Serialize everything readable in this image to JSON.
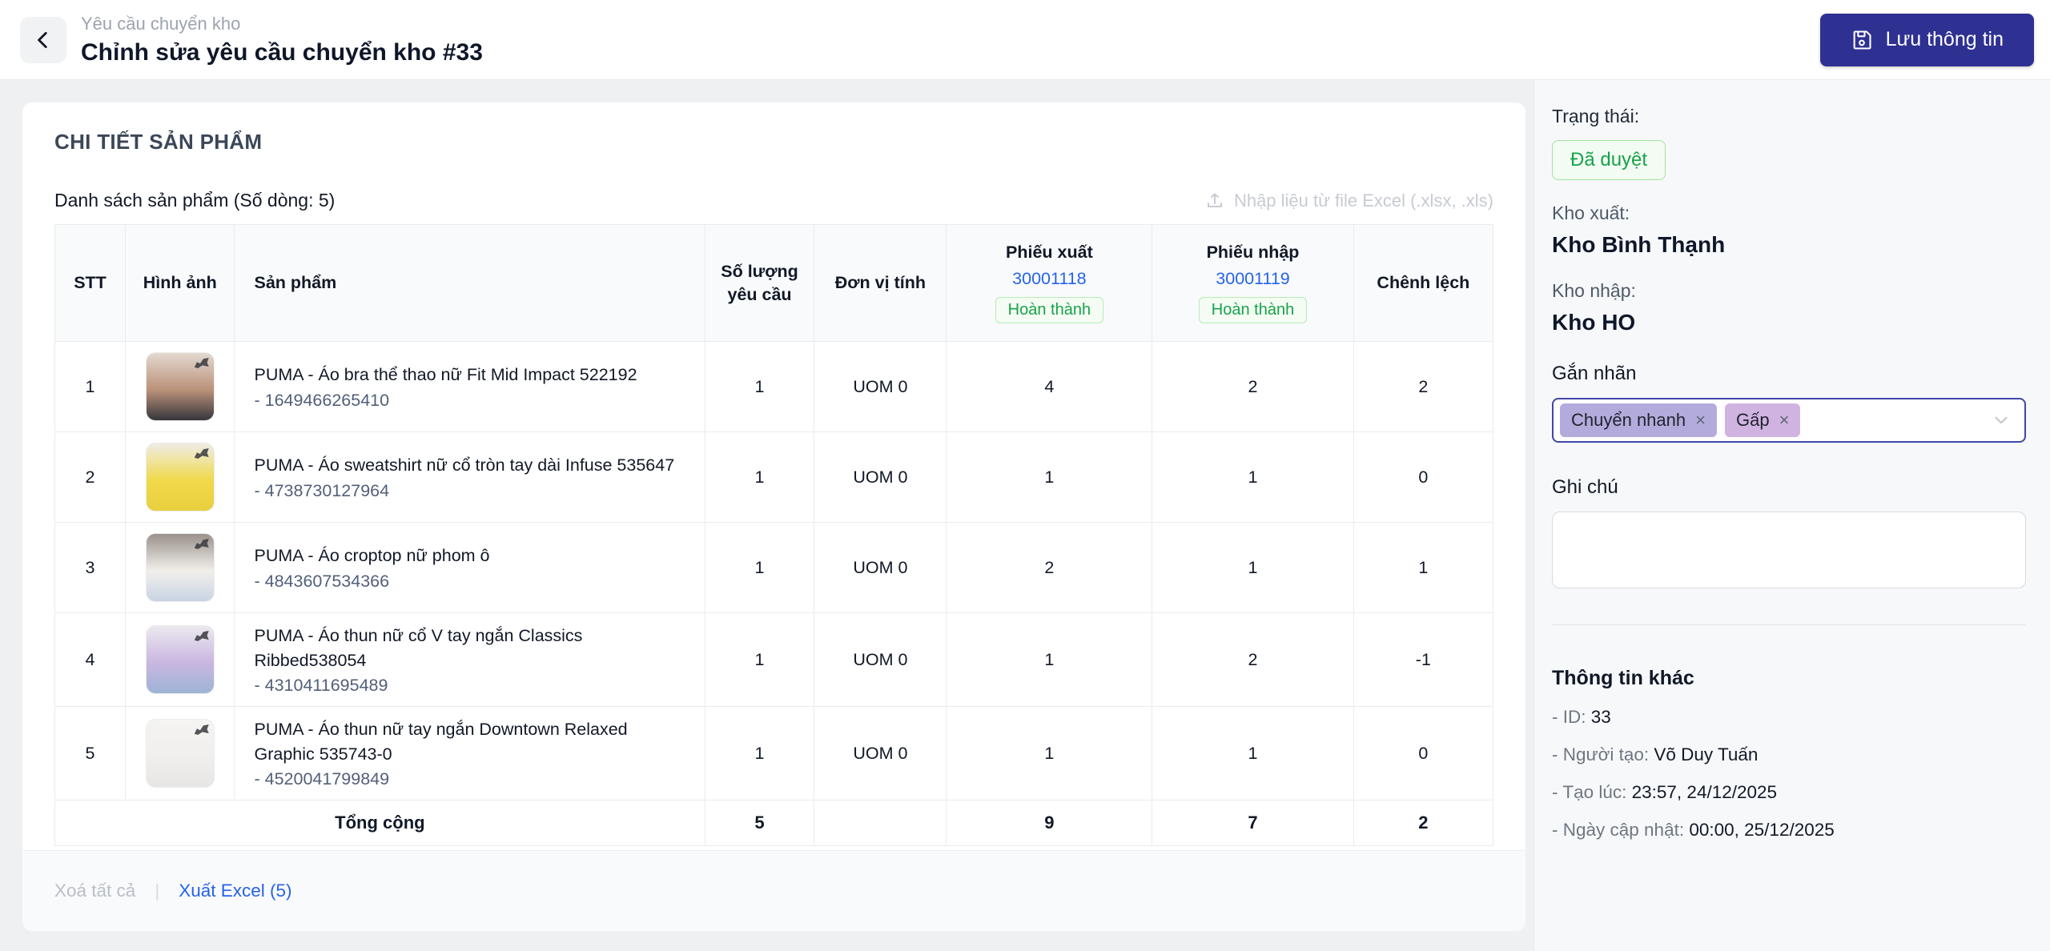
{
  "header": {
    "breadcrumb": "Yêu cầu chuyển kho",
    "title": "Chỉnh sửa yêu cầu chuyển kho #33",
    "save_label": "Lưu thông tin"
  },
  "colors": {
    "accent": "#2e3192",
    "link_blue": "#2563eb",
    "status_green": "#16a34a",
    "tag_fast_bg": "#b3abdb",
    "tag_urgent_bg": "#d1b3e2"
  },
  "products": {
    "section_title": "CHI TIẾT SẢN PHẨM",
    "list_label": "Danh sách sản phẩm (Số dòng: 5)",
    "import_label": "Nhập liệu từ file Excel (.xlsx, .xls)",
    "import_icon": "upload-icon",
    "table": {
      "headers": {
        "stt": "STT",
        "image": "Hình ảnh",
        "product": "Sản phẩm",
        "qty_line1": "Số lượng",
        "qty_line2": "yêu cầu",
        "uom": "Đơn vị tính",
        "export_label": "Phiếu xuất",
        "export_code": "30001118",
        "export_status": "Hoàn thành",
        "import_label": "Phiếu nhập",
        "import_code": "30001119",
        "import_status": "Hoàn thành",
        "diff": "Chênh lệch"
      },
      "rows": [
        {
          "stt": "1",
          "name": "PUMA - Áo bra thể thao nữ Fit Mid Impact 522192",
          "code": "- 1649466265410",
          "qty": "1",
          "uom": "UOM 0",
          "export": "4",
          "import": "2",
          "diff": "2",
          "thumb": [
            "#e3d9d0",
            "#bb9179",
            "#35363c"
          ]
        },
        {
          "stt": "2",
          "name": "PUMA - Áo sweatshirt nữ cổ tròn tay dài Infuse 535647",
          "code": "- 4738730127964",
          "qty": "1",
          "uom": "UOM 0",
          "export": "1",
          "import": "1",
          "diff": "0",
          "thumb": [
            "#efece6",
            "#f0d94a",
            "#e9cf3e"
          ]
        },
        {
          "stt": "3",
          "name": "PUMA - Áo croptop nữ phom ô",
          "code": "- 4843607534366",
          "qty": "1",
          "uom": "UOM 0",
          "export": "2",
          "import": "1",
          "diff": "1",
          "thumb": [
            "#9a928b",
            "#f2efec",
            "#c9d4e4"
          ]
        },
        {
          "stt": "4",
          "name": "PUMA - Áo thun nữ cổ V tay ngắn Classics Ribbed538054",
          "code": "- 4310411695489",
          "qty": "1",
          "uom": "UOM 0",
          "export": "1",
          "import": "2",
          "diff": "-1",
          "thumb": [
            "#ece9ef",
            "#c9b6e0",
            "#9db4d6"
          ]
        },
        {
          "stt": "5",
          "name": "PUMA - Áo thun nữ tay ngắn Downtown Relaxed Graphic 535743-0",
          "code": "- 4520041799849",
          "qty": "1",
          "uom": "UOM 0",
          "export": "1",
          "import": "1",
          "diff": "0",
          "thumb": [
            "#f5f4f3",
            "#f0efed",
            "#e7e6e4"
          ]
        }
      ],
      "total": {
        "label": "Tổng cộng",
        "qty": "5",
        "uom": "",
        "export": "9",
        "import": "7",
        "diff": "2"
      }
    },
    "footer": {
      "clear_all": "Xoá tất cả",
      "separator": "|",
      "export_excel": "Xuất Excel (5)"
    }
  },
  "sidebar": {
    "status_label": "Trạng thái:",
    "status_value": "Đã duyệt",
    "source_label": "Kho xuất:",
    "source_value": "Kho Bình Thạnh",
    "dest_label": "Kho nhập:",
    "dest_value": "Kho HO",
    "tags_label": "Gắn nhãn",
    "tags": [
      {
        "label": "Chuyển nhanh",
        "remove": "×",
        "bg": "#b3abdb"
      },
      {
        "label": "Gấp",
        "remove": "×",
        "bg": "#d1b3e2"
      }
    ],
    "note_label": "Ghi chú",
    "note_value": "",
    "info_title": "Thông tin khác",
    "info": [
      {
        "label": "- ID:",
        "value": "33"
      },
      {
        "label": "- Người tạo:",
        "value": "Võ Duy Tuấn"
      },
      {
        "label": "- Tạo lúc:",
        "value": "23:57, 24/12/2025"
      },
      {
        "label": "- Ngày cập nhật:",
        "value": "00:00, 25/12/2025"
      }
    ]
  }
}
